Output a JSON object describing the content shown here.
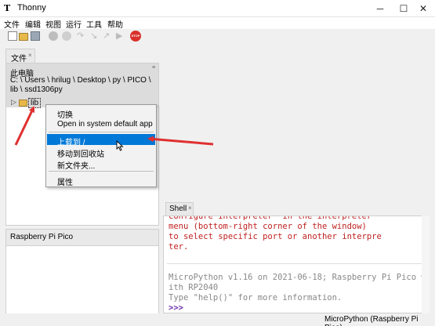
{
  "window": {
    "title": "Thonny",
    "app_icon": "T",
    "min_glyph": "─",
    "max_glyph": "☐",
    "close_glyph": "✕"
  },
  "menu": [
    "文件",
    "编辑",
    "视图",
    "运行",
    "工具",
    "帮助"
  ],
  "toolbar": {
    "icons": [
      "new-file-icon",
      "open-folder-icon",
      "save-icon",
      "run-icon",
      "debug-icon",
      "step-over-icon",
      "step-into-icon",
      "step-out-icon",
      "resume-icon",
      "stop-icon"
    ],
    "stop_label": "STOP"
  },
  "files": {
    "tab_label": "文件",
    "tab_close": "×",
    "computer_label": "此电脑",
    "path_line1": "C: \\ Users \\ hrilug \\ Desktop \\ py \\ PICO \\",
    "path_line2": "lib \\ ssd1306py",
    "tree_item": "lib",
    "expand_glyph": "▷"
  },
  "context_menu": {
    "items": [
      "切换",
      "Open in system default app",
      "上载到 /",
      "移动到回收站",
      "新文件夹...",
      "属性"
    ],
    "selected": "上载到 /"
  },
  "pico_panel": {
    "tab_label": "Raspberry Pi Pico"
  },
  "shell": {
    "tab_label": "Shell",
    "tab_close": "×",
    "error_lines": [
      "configure interpreter  in the interpreter",
      "menu (bottom-right corner of the window)",
      "to select specific port or another interpre",
      "ter."
    ],
    "info_lines": [
      "MicroPython v1.16 on 2021-06-18; Raspberry Pi Pico w",
      "ith RP2040",
      "Type \"help()\" for more information."
    ],
    "prompt": ">>>"
  },
  "status": {
    "interpreter": "MicroPython (Raspberry Pi Pico)"
  },
  "colors": {
    "selection": "#0078d7",
    "arrow": "#e03030",
    "error_text": "#c02020"
  }
}
